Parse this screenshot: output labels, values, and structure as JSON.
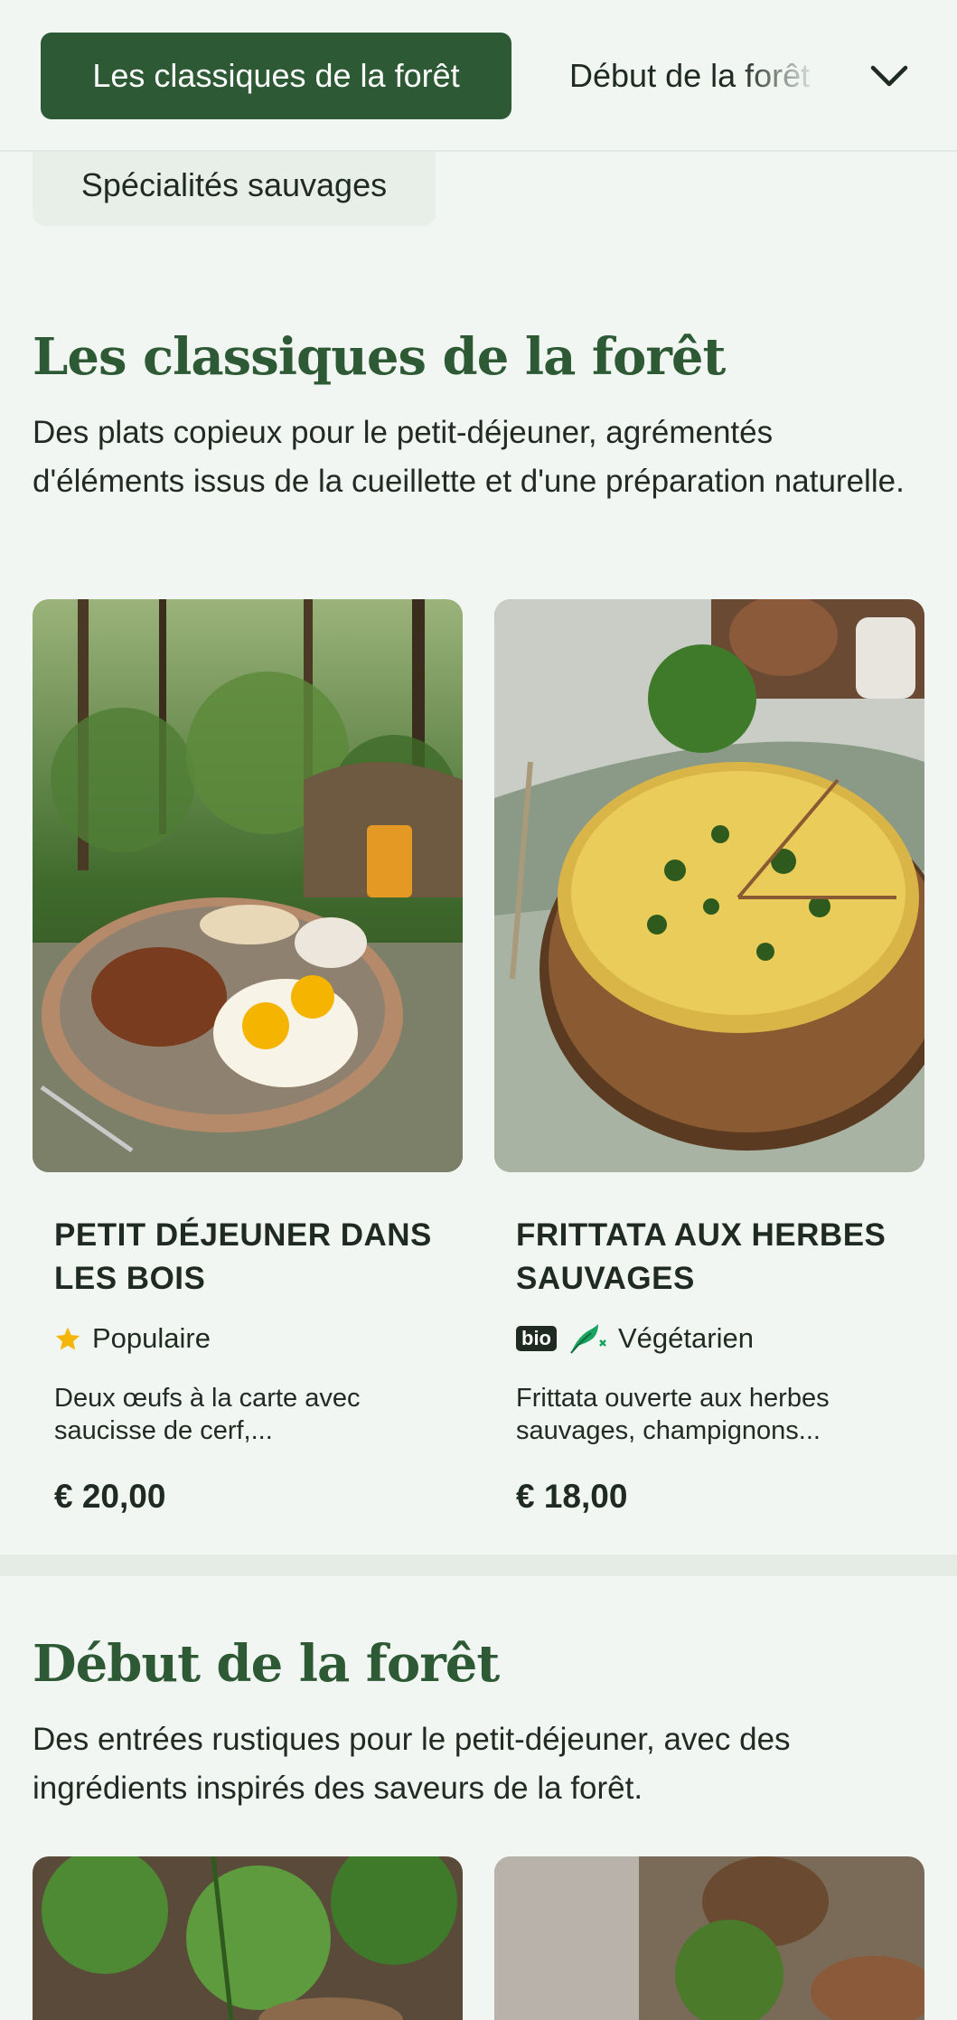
{
  "nav": {
    "active_category": "Les classiques de la forêt",
    "next_category": "Début de la forêt",
    "wild_category": "Spécialités sauvages",
    "expand_icon": "chevron-down-icon"
  },
  "sections": [
    {
      "title": "Les classiques de la forêt",
      "description": "Des plats copieux pour le petit-déjeuner, agrémentés d'éléments issus de la cueillette et d'une préparation naturelle.",
      "items": [
        {
          "name": "PETIT DÉJEUNER DANS LES BOIS",
          "tag_icon": "star-icon",
          "tag": "Populaire",
          "description": "Deux œufs à la carte avec saucisse de cerf,...",
          "price": "€ 20,00"
        },
        {
          "name": "FRITTATA AUX HERBES SAUVAGES",
          "badge": "bio",
          "tag_icon": "vegetarian-icon",
          "tag": "Végétarien",
          "description": "Frittata ouverte aux herbes sauvages, champignons...",
          "price": "€ 18,00"
        }
      ]
    },
    {
      "title": "Début de la forêt",
      "description": "Des entrées rustiques pour le petit-déjeuner, avec des ingrédients inspirés des saveurs de la forêt."
    }
  ],
  "colors": {
    "brand": "#2d5a35",
    "background": "#f2f6f2",
    "star": "#f5b60a",
    "vegetarian": "#1aa260"
  }
}
